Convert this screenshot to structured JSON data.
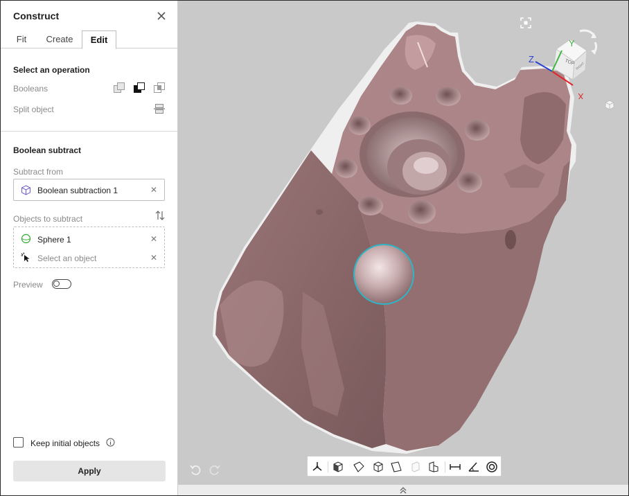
{
  "panel": {
    "title": "Construct",
    "tabs": [
      {
        "label": "Fit",
        "active": false
      },
      {
        "label": "Create",
        "active": false
      },
      {
        "label": "Edit",
        "active": true
      }
    ],
    "select_operation": {
      "title": "Select an operation",
      "booleans_label": "Booleans",
      "split_label": "Split object"
    },
    "boolean_subtract": {
      "title": "Boolean subtract",
      "subtract_from_label": "Subtract from",
      "subtract_from_value": "Boolean subtraction 1",
      "objects_label": "Objects to subtract",
      "objects": [
        {
          "name": "Sphere 1",
          "icon": "sphere-icon"
        }
      ],
      "select_placeholder": "Select an object",
      "preview_label": "Preview",
      "preview_on": false
    },
    "keep_initial_label": "Keep initial objects",
    "apply_label": "Apply"
  },
  "viewport": {
    "axis_labels": {
      "x": "X",
      "y": "Y",
      "z": "Z"
    },
    "cube_top_label": "TOP",
    "cube_right_label": "RIGHT",
    "colors": {
      "background": "#c9c9c9",
      "model": "#a98486",
      "selection": "#2fb6c6",
      "axis_x": "#e0262a",
      "axis_y": "#3db53d",
      "axis_z": "#2a3fd0"
    }
  },
  "toolbar": {
    "tools": [
      "triad-icon",
      "view-front-icon",
      "view-left-icon",
      "view-iso-icon",
      "view-right-icon",
      "view-back-icon",
      "view-section-icon",
      "measure-distance-icon",
      "measure-angle-icon",
      "measure-radius-icon"
    ]
  }
}
